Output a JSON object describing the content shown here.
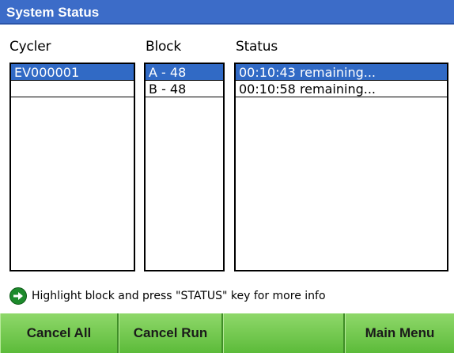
{
  "title": "System Status",
  "columns": {
    "cycler": "Cycler",
    "block": "Block",
    "status": "Status"
  },
  "cycler_list": [
    "EV000001"
  ],
  "block_list": [
    "A - 48",
    "B - 48"
  ],
  "status_list": [
    "00:10:43 remaining...",
    "00:10:58 remaining..."
  ],
  "hint": "Highlight block and press \"STATUS\" key for more info",
  "softkeys": {
    "cancel_all": "Cancel All",
    "cancel_run": "Cancel Run",
    "blank": "",
    "main_menu": "Main Menu"
  },
  "colors": {
    "title_bar": "#3c6cc8",
    "selection": "#316ac5",
    "softkey": "#6cc24a",
    "hint_icon": "#1d8a2c"
  },
  "icons": {
    "hint": "arrow-right-circle-icon"
  }
}
